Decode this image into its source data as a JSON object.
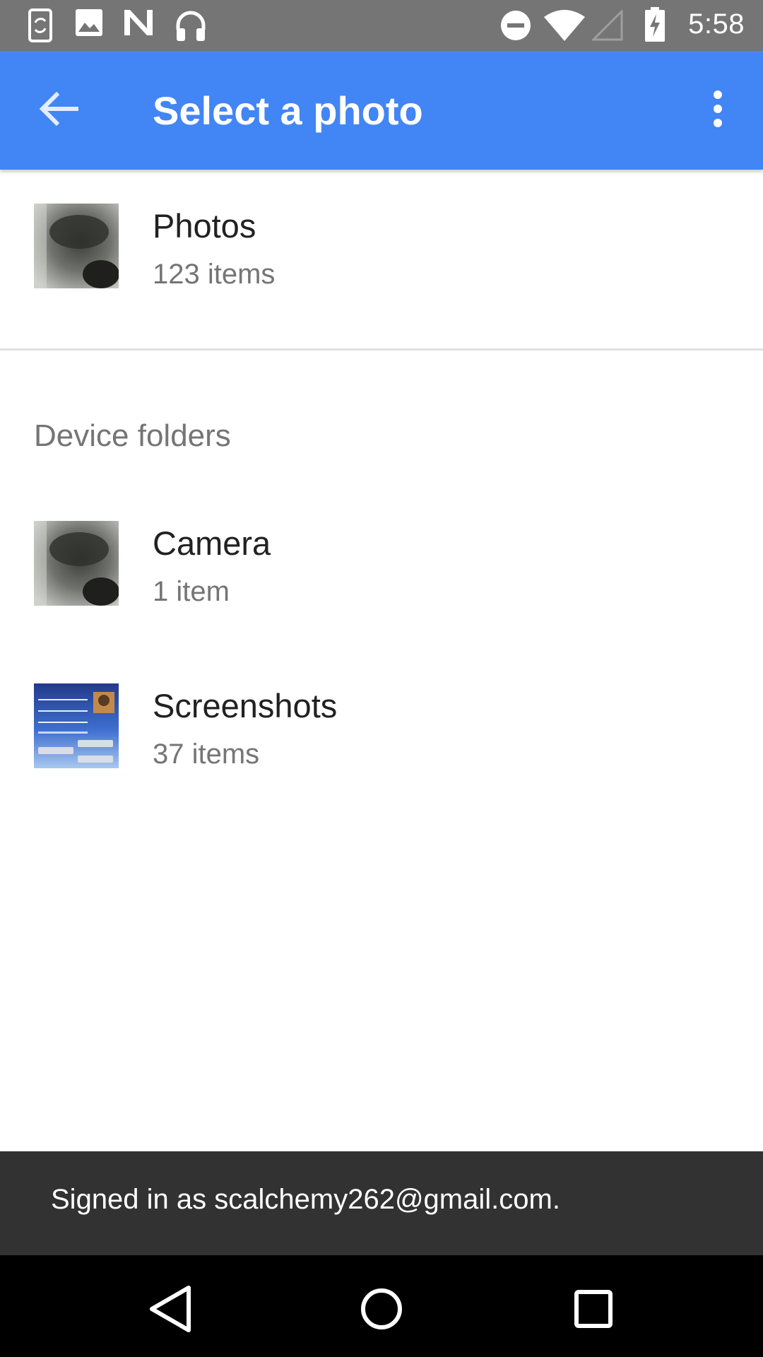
{
  "status_bar": {
    "time": "5:58",
    "left_icons": [
      "phone-sync-icon",
      "image-icon",
      "n-logo-icon",
      "headphones-icon"
    ],
    "right_icons": [
      "do-not-disturb-icon",
      "wifi-icon",
      "signal-icon",
      "battery-charging-icon"
    ]
  },
  "app_bar": {
    "title": "Select a photo",
    "back_icon": "arrow-back-icon",
    "menu_icon": "more-vert-icon",
    "color": "#4285f4"
  },
  "photos_album": {
    "name": "Photos",
    "count": "123 items"
  },
  "device_folders": {
    "header": "Device folders",
    "items": [
      {
        "name": "Camera",
        "count": "1 item"
      },
      {
        "name": "Screenshots",
        "count": "37 items"
      }
    ]
  },
  "snackbar": {
    "message": "Signed in as scalchemy262@gmail.com."
  },
  "nav_bar": {
    "icons": [
      "back-triangle-icon",
      "home-circle-icon",
      "recents-square-icon"
    ]
  }
}
